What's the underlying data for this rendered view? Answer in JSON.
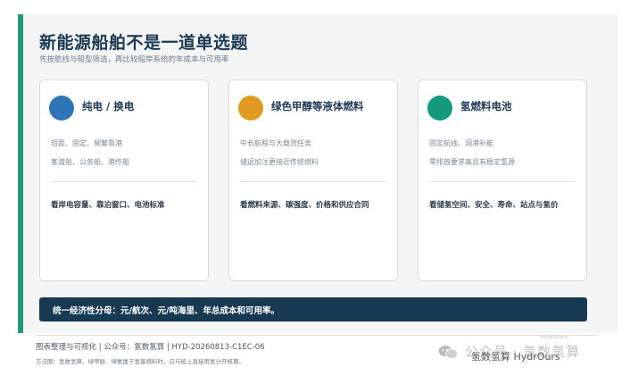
{
  "header": {
    "title": "新能源船舶不是一道单选题",
    "subtitle": "先按航线与船型筛选，再比较船岸系统的年成本与可用率"
  },
  "cards": [
    {
      "title": "纯电 / 换电",
      "color": "#2f74b5",
      "lines": [
        "短距、固定、频繁靠港",
        "客渡船、公务船、港作船"
      ],
      "focus": "看岸电容量、靠泊窗口、电池标准"
    },
    {
      "title": "绿色甲醇等液体燃料",
      "color": "#e09a22",
      "lines": [
        "中长航程与大载货任务",
        "储运加注更接近传统燃料"
      ],
      "focus": "看燃料来源、碳强度、价格和供应合同"
    },
    {
      "title": "氢燃料电池",
      "color": "#15997c",
      "lines": [
        "固定航线、洞港补能",
        "零排放要求高且有稳定氢源"
      ],
      "focus": "看储氢空间、安全、寿命、站点与氢价"
    }
  ],
  "banner": {
    "text": "统一经济性分母：元/航次、元/吨海里、年总成本和可用率。"
  },
  "ghost_small": "HydrOurs",
  "footer": {
    "line1": "图表整理与可视化 | 公众号：氢数氢算 | HYD-20260813-C1EC-06",
    "line2": "方法图：氢数氢算。绿甲醇、绿氨属于氢基燃料时，应与船上直接用氢分开核算。"
  },
  "watermark": {
    "big": "公众号 · 氢数氢算",
    "dark": "氢数氢算 HydrOurs",
    "icon": "wechat-icon"
  }
}
